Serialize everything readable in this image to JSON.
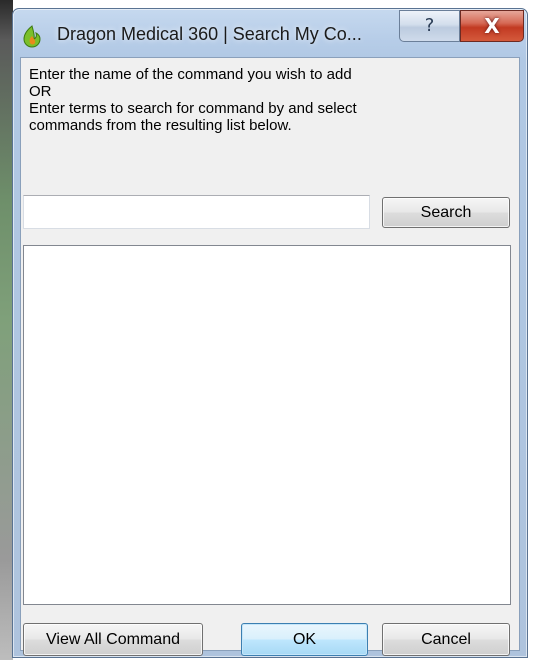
{
  "window": {
    "title": "Dragon Medical 360 | Search My Co...",
    "help_label": "?",
    "close_label": "X"
  },
  "instructions": {
    "line1": "Enter the name of the command you wish to add",
    "line2": "OR",
    "line3": "Enter terms to search for command by and select",
    "line4": "commands from the resulting list below."
  },
  "search": {
    "value": "",
    "placeholder": "",
    "button_label": "Search"
  },
  "results": {
    "items": []
  },
  "footer": {
    "view_all_label": "View All Command",
    "ok_label": "OK",
    "cancel_label": "Cancel"
  },
  "colors": {
    "title_bar": "#b7cde8",
    "close_button": "#c23a22",
    "client_background": "#f0f0f0",
    "app_icon": "#7bbf2a"
  },
  "icons": {
    "app": "dragon-flame-icon",
    "help": "question-mark-icon",
    "close": "close-x-icon"
  }
}
